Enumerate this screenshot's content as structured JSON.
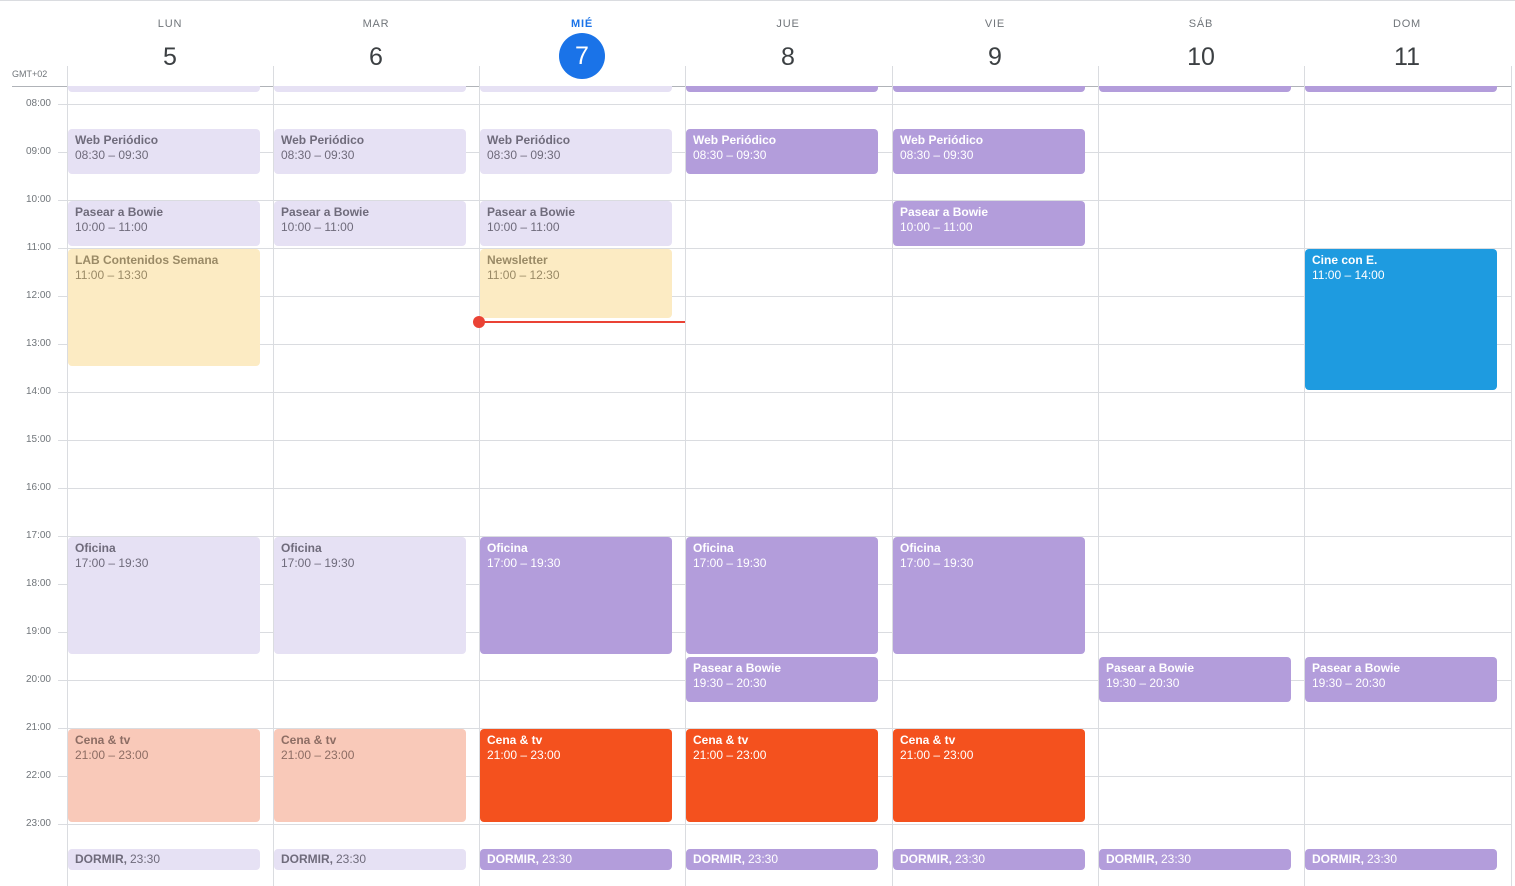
{
  "timezone": "GMT+02",
  "days": [
    {
      "dow": "LUN",
      "num": "5",
      "today": false
    },
    {
      "dow": "MAR",
      "num": "6",
      "today": false
    },
    {
      "dow": "MIÉ",
      "num": "7",
      "today": true
    },
    {
      "dow": "JUE",
      "num": "8",
      "today": false
    },
    {
      "dow": "VIE",
      "num": "9",
      "today": false
    },
    {
      "dow": "SÁB",
      "num": "10",
      "today": false
    },
    {
      "dow": "DOM",
      "num": "11",
      "today": false
    }
  ],
  "hours": [
    "08:00",
    "09:00",
    "10:00",
    "11:00",
    "12:00",
    "13:00",
    "14:00",
    "15:00",
    "16:00",
    "17:00",
    "18:00",
    "19:00",
    "20:00",
    "21:00",
    "22:00",
    "23:00"
  ],
  "now_time": "12:30",
  "colors": {
    "past_purple_bg": "#e6e1f4",
    "past_purple_text": "#6f6b7b",
    "purple_bg": "#b39ddb",
    "purple_text": "#ffffff",
    "past_yellow_bg": "#fcebc3",
    "past_yellow_text": "#9a8a66",
    "past_salmon_bg": "#f9c9b9",
    "past_salmon_text": "#8d6d64",
    "red_bg": "#f4511e",
    "blue_bg": "#1e9be0",
    "now_line": "#ea4335",
    "today_accent": "#1a73e8"
  },
  "events": [
    {
      "day": 0,
      "start": "07:50",
      "end": "08:05",
      "title": "",
      "time": "",
      "style": "past_purple",
      "top_stub": true
    },
    {
      "day": 1,
      "start": "07:50",
      "end": "08:05",
      "title": "",
      "time": "",
      "style": "past_purple",
      "top_stub": true
    },
    {
      "day": 2,
      "start": "07:50",
      "end": "08:05",
      "title": "",
      "time": "",
      "style": "past_purple",
      "top_stub": true
    },
    {
      "day": 3,
      "start": "07:50",
      "end": "08:05",
      "title": "",
      "time": "",
      "style": "purple",
      "top_stub": true
    },
    {
      "day": 4,
      "start": "07:50",
      "end": "08:05",
      "title": "",
      "time": "",
      "style": "purple",
      "top_stub": true
    },
    {
      "day": 5,
      "start": "07:50",
      "end": "08:05",
      "title": "",
      "time": "",
      "style": "purple",
      "top_stub": true
    },
    {
      "day": 6,
      "start": "07:50",
      "end": "08:05",
      "title": "",
      "time": "",
      "style": "purple",
      "top_stub": true
    },
    {
      "day": 0,
      "start": "08:30",
      "end": "09:30",
      "title": "Web Periódico",
      "time": "08:30 – 09:30",
      "style": "past_purple"
    },
    {
      "day": 1,
      "start": "08:30",
      "end": "09:30",
      "title": "Web Periódico",
      "time": "08:30 – 09:30",
      "style": "past_purple"
    },
    {
      "day": 2,
      "start": "08:30",
      "end": "09:30",
      "title": "Web Periódico",
      "time": "08:30 – 09:30",
      "style": "past_purple"
    },
    {
      "day": 3,
      "start": "08:30",
      "end": "09:30",
      "title": "Web Periódico",
      "time": "08:30 – 09:30",
      "style": "purple"
    },
    {
      "day": 4,
      "start": "08:30",
      "end": "09:30",
      "title": "Web Periódico",
      "time": "08:30 – 09:30",
      "style": "purple"
    },
    {
      "day": 0,
      "start": "10:00",
      "end": "11:00",
      "title": "Pasear a Bowie",
      "time": "10:00 – 11:00",
      "style": "past_purple"
    },
    {
      "day": 1,
      "start": "10:00",
      "end": "11:00",
      "title": "Pasear a Bowie",
      "time": "10:00 – 11:00",
      "style": "past_purple"
    },
    {
      "day": 2,
      "start": "10:00",
      "end": "11:00",
      "title": "Pasear a Bowie",
      "time": "10:00 – 11:00",
      "style": "past_purple"
    },
    {
      "day": 4,
      "start": "10:00",
      "end": "11:00",
      "title": "Pasear a Bowie",
      "time": "10:00 – 11:00",
      "style": "purple"
    },
    {
      "day": 0,
      "start": "11:00",
      "end": "13:30",
      "title": "LAB Contenidos Semana",
      "time": "11:00 – 13:30",
      "style": "past_yellow"
    },
    {
      "day": 2,
      "start": "11:00",
      "end": "12:30",
      "title": "Newsletter",
      "time": "11:00 – 12:30",
      "style": "past_yellow"
    },
    {
      "day": 6,
      "start": "11:00",
      "end": "14:00",
      "title": "Cine con E.",
      "time": "11:00 – 14:00",
      "style": "blue"
    },
    {
      "day": 0,
      "start": "17:00",
      "end": "19:30",
      "title": "Oficina",
      "time": "17:00 – 19:30",
      "style": "past_purple"
    },
    {
      "day": 1,
      "start": "17:00",
      "end": "19:30",
      "title": "Oficina",
      "time": "17:00 – 19:30",
      "style": "past_purple"
    },
    {
      "day": 2,
      "start": "17:00",
      "end": "19:30",
      "title": "Oficina",
      "time": "17:00 – 19:30",
      "style": "purple"
    },
    {
      "day": 3,
      "start": "17:00",
      "end": "19:30",
      "title": "Oficina",
      "time": "17:00 – 19:30",
      "style": "purple"
    },
    {
      "day": 4,
      "start": "17:00",
      "end": "19:30",
      "title": "Oficina",
      "time": "17:00 – 19:30",
      "style": "purple"
    },
    {
      "day": 3,
      "start": "19:30",
      "end": "20:30",
      "title": "Pasear a Bowie",
      "time": "19:30 – 20:30",
      "style": "purple"
    },
    {
      "day": 5,
      "start": "19:30",
      "end": "20:30",
      "title": "Pasear a Bowie",
      "time": "19:30 – 20:30",
      "style": "purple"
    },
    {
      "day": 6,
      "start": "19:30",
      "end": "20:30",
      "title": "Pasear a Bowie",
      "time": "19:30 – 20:30",
      "style": "purple"
    },
    {
      "day": 0,
      "start": "21:00",
      "end": "23:00",
      "title": "Cena & tv",
      "time": "21:00 – 23:00",
      "style": "past_salmon"
    },
    {
      "day": 1,
      "start": "21:00",
      "end": "23:00",
      "title": "Cena & tv",
      "time": "21:00 – 23:00",
      "style": "past_salmon"
    },
    {
      "day": 2,
      "start": "21:00",
      "end": "23:00",
      "title": "Cena & tv",
      "time": "21:00 – 23:00",
      "style": "red"
    },
    {
      "day": 3,
      "start": "21:00",
      "end": "23:00",
      "title": "Cena & tv",
      "time": "21:00 – 23:00",
      "style": "red"
    },
    {
      "day": 4,
      "start": "21:00",
      "end": "23:00",
      "title": "Cena & tv",
      "time": "21:00 – 23:00",
      "style": "red"
    },
    {
      "day": 0,
      "start": "23:30",
      "end": "24:00",
      "title": "DORMIR",
      "time": "23:30",
      "style": "past_purple",
      "compact": true
    },
    {
      "day": 1,
      "start": "23:30",
      "end": "24:00",
      "title": "DORMIR",
      "time": "23:30",
      "style": "past_purple",
      "compact": true
    },
    {
      "day": 2,
      "start": "23:30",
      "end": "24:00",
      "title": "DORMIR",
      "time": "23:30",
      "style": "purple",
      "compact": true
    },
    {
      "day": 3,
      "start": "23:30",
      "end": "24:00",
      "title": "DORMIR",
      "time": "23:30",
      "style": "purple",
      "compact": true
    },
    {
      "day": 4,
      "start": "23:30",
      "end": "24:00",
      "title": "DORMIR",
      "time": "23:30",
      "style": "purple",
      "compact": true
    },
    {
      "day": 5,
      "start": "23:30",
      "end": "24:00",
      "title": "DORMIR",
      "time": "23:30",
      "style": "purple",
      "compact": true
    },
    {
      "day": 6,
      "start": "23:30",
      "end": "24:00",
      "title": "DORMIR",
      "time": "23:30",
      "style": "purple",
      "compact": true
    }
  ]
}
